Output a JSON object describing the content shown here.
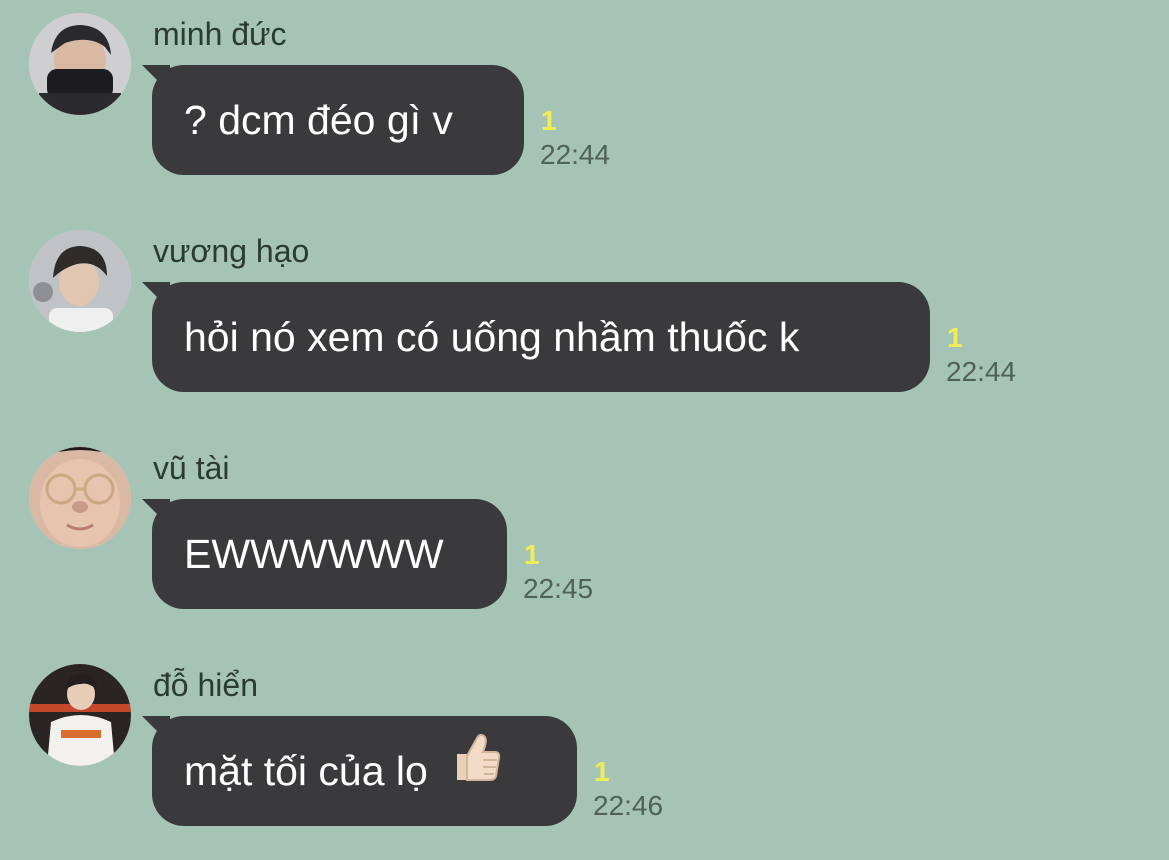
{
  "messages": [
    {
      "sender": "minh đức",
      "text": "? dcm đéo gì v",
      "unread": "1",
      "time": "22:44",
      "avatar_icon": "avatar-photo"
    },
    {
      "sender": "vương hạo",
      "text": "hỏi nó xem có uống nhầm thuốc k",
      "unread": "1",
      "time": "22:44",
      "avatar_icon": "avatar-photo"
    },
    {
      "sender": "vũ tài",
      "text": "EWWWWWW",
      "unread": "1",
      "time": "22:45",
      "avatar_icon": "avatar-photo"
    },
    {
      "sender": "đỗ hiển",
      "text": "mặt tối của lọ",
      "emoji": "thumbs-up-icon",
      "unread": "1",
      "time": "22:46",
      "avatar_icon": "avatar-photo"
    }
  ],
  "colors": {
    "background": "#a6c4b6",
    "bubble": "#3a3a3c",
    "unread": "#f1ee55",
    "time": "#4f6158"
  }
}
